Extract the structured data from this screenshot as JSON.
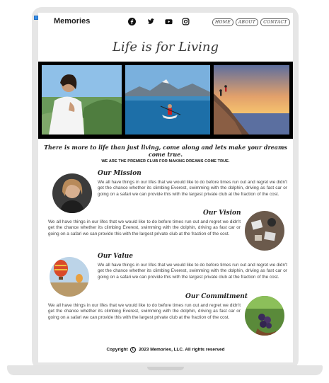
{
  "header": {
    "brand": "Memories",
    "social_icons": [
      "facebook-icon",
      "twitter-icon",
      "youtube-icon",
      "instagram-icon"
    ],
    "nav": [
      "HOME",
      "ABOUT",
      "CONTACT"
    ]
  },
  "hero": {
    "title": "Life is for Living",
    "photos": [
      "woman-on-hillside-photo",
      "kayaker-on-lake-photo",
      "hikers-on-cliff-sunset-photo"
    ]
  },
  "tagline": "There is more to life than just living, come along and lets make your dreams come true.",
  "subtag": "WE ARE THE PREMIER CLUB FOR MAKING DREAMS COME TRUE.",
  "sections": [
    {
      "title": "Our Mission",
      "body": "We all have things in our lifes that we would like to do before times run out and regret we didn't get the chance whether its climbing Everest, swimming with the dolphin, driving as fast car or going on a safari we can provide this with the largest private club at the fraction of the cost."
    },
    {
      "title": "Our Vision",
      "body": "We all have things in our lifes that we would like to do before times run out and regret we didn't get the chance whether its climbing Everest, swimming with the dolphin, driving as fast car or going on a safari we can provide this with the largest private club at the fraction of the cost."
    },
    {
      "title": "Our Value",
      "body": "We all have things in our lifes that we would like to do before times run out and regret we didn't get the chance whether its climbing Everest, swimming with the dolphin, driving as fast car or going on a safari we can provide this with the largest private club at the fraction of the cost."
    },
    {
      "title": "Our Commitment",
      "body": "We all have things in our lifes that we would like to do before times run out and regret we didn't get the chance whether its climbing Everest, swimming with the dolphin, driving as fast car or going on a safari we can provide this with the largest private club at the fraction of the cost."
    }
  ],
  "footer": {
    "prefix": "Copyright",
    "symbol": "C",
    "text": "2023 Memories, LLC. All rights reserved"
  },
  "colors": {
    "frame": "#e6e6e6",
    "strip": "#000000",
    "text": "#222222"
  }
}
